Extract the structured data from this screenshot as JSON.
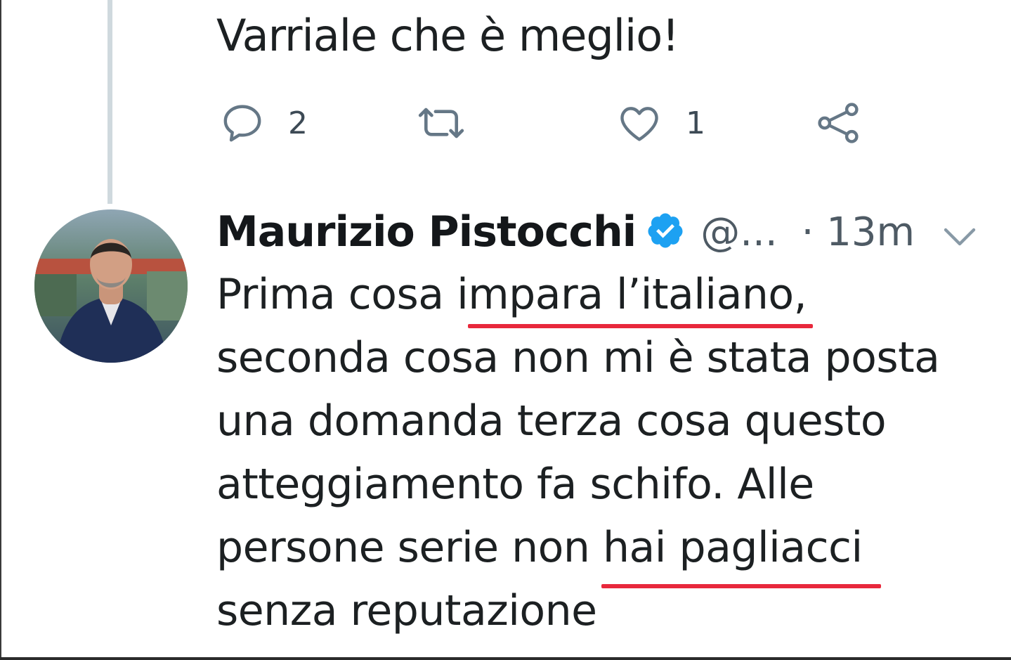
{
  "previous_tweet": {
    "text": "Varriale che è meglio!",
    "actions": {
      "reply_count": "2",
      "retweet_count": "",
      "like_count": "1"
    }
  },
  "tweet": {
    "author_name": "Maurizio Pistocchi",
    "handle": "@...",
    "time": "· 13m",
    "lines": [
      {
        "before": "Prima cosa ",
        "highlight": "impara l’italiano,",
        "after": ""
      },
      {
        "before": "seconda cosa non mi è stata posta",
        "highlight": "",
        "after": ""
      },
      {
        "before": "una domanda terza cosa questo",
        "highlight": "",
        "after": ""
      },
      {
        "before": "atteggiamento fa schifo. Alle",
        "highlight": "",
        "after": ""
      },
      {
        "before": "persone serie non ",
        "highlight": "hai pagliacci",
        "after": ""
      },
      {
        "before": "senza reputazione",
        "highlight": "",
        "after": ""
      }
    ]
  },
  "colors": {
    "text": "#1c2022",
    "secondary": "#657786",
    "verified": "#1da1f2",
    "underline": "#e8283c",
    "thread_line": "#cfd9de"
  },
  "icons": {
    "reply": "speech-bubble-icon",
    "retweet": "retweet-arrows-icon",
    "like": "heart-outline-icon",
    "share": "share-nodes-icon",
    "verified": "verified-badge-icon",
    "menu": "chevron-down-icon"
  }
}
